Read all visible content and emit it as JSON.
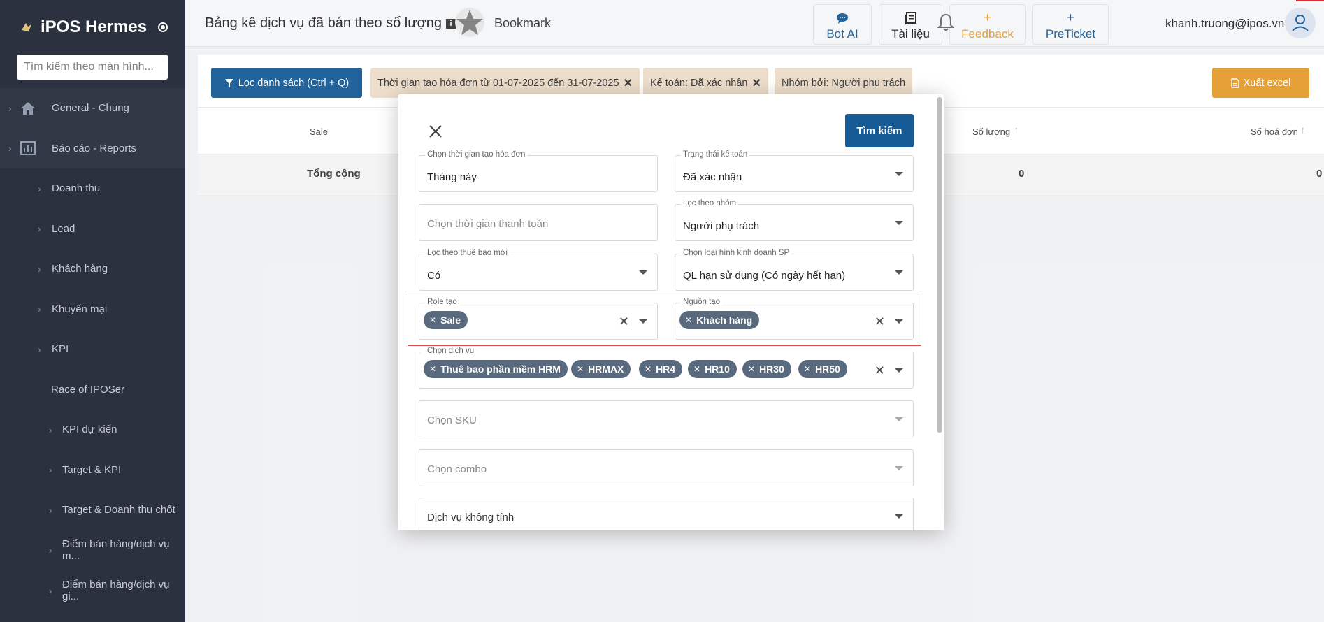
{
  "sidebar": {
    "app_name": "iPOS Hermes",
    "search_placeholder": "Tìm kiếm theo màn hình...",
    "items": [
      {
        "label": "General - Chung"
      },
      {
        "label": "Báo cáo - Reports"
      },
      {
        "label": "Doanh thu"
      },
      {
        "label": "Lead"
      },
      {
        "label": "Khách hàng"
      },
      {
        "label": "Khuyến mại"
      },
      {
        "label": "KPI"
      },
      {
        "label": "Race of IPOSer"
      },
      {
        "label": "KPI dự kiến"
      },
      {
        "label": "Target & KPI"
      },
      {
        "label": "Target & Doanh thu chốt"
      },
      {
        "label": "Điểm bán hàng/dịch vụ m..."
      },
      {
        "label": "Điểm bán hàng/dịch vụ gi..."
      }
    ]
  },
  "header": {
    "title": "Bảng kê dịch vụ đã bán theo số lượng",
    "bookmark": "Bookmark",
    "buttons": {
      "bot_ai": "Bot AI",
      "tai_lieu": "Tài liệu",
      "feedback": "Feedback",
      "preticket": "PreTicket"
    },
    "user_email": "khanh.truong@ipos.vn"
  },
  "toolbar": {
    "filter_button": "Lọc danh sách (Ctrl + Q)",
    "chips": [
      "Thời gian tạo hóa đơn từ 01-07-2025 đến 31-07-2025",
      "Kế toán: Đã xác nhận",
      "Nhóm bởi: Người phụ trách"
    ],
    "export_button": "Xuất excel"
  },
  "table": {
    "headers": {
      "sale": "Sale",
      "so_luong": "Số lượng",
      "so_hoa_don": "Số hoá đơn"
    },
    "total_label": "Tổng cộng",
    "total_so_luong": "0",
    "total_so_hoa_don": "0"
  },
  "modal": {
    "search_button": "Tìm kiếm",
    "fields": {
      "thoi_gian_tao": {
        "label": "Chọn thời gian tạo hóa đơn",
        "value": "Tháng này"
      },
      "trang_thai_ke_toan": {
        "label": "Trạng thái kế toán",
        "value": "Đã xác nhận"
      },
      "thoi_gian_thanh_toan": {
        "placeholder": "Chọn thời gian thanh toán"
      },
      "loc_theo_nhom": {
        "label": "Lọc theo nhóm",
        "value": "Người phụ trách"
      },
      "thue_bao_moi": {
        "label": "Lọc theo thuê bao mới",
        "value": "Có"
      },
      "loai_hinh_kinh_doanh": {
        "label": "Chọn loại hình kinh doanh SP",
        "value": "QL hạn sử dụng (Có ngày hết hạn)"
      },
      "role_tao": {
        "label": "Role tạo",
        "tags": [
          "Sale"
        ]
      },
      "nguon_tao": {
        "label": "Nguồn tạo",
        "tags": [
          "Khách hàng"
        ]
      },
      "dich_vu": {
        "label": "Chọn dịch vụ",
        "tags": [
          "Thuê bao phần mềm HRM",
          "HRMAX",
          "HR4",
          "HR10",
          "HR30",
          "HR50"
        ]
      },
      "sku": {
        "placeholder": "Chọn SKU"
      },
      "combo": {
        "placeholder": "Chọn combo"
      },
      "dich_vu_khong_tinh": {
        "placeholder": "Dịch vụ không tính"
      }
    }
  },
  "colors": {
    "sidebar_bg": "#1f2533",
    "primary": "#165a96",
    "export": "#e59b2c",
    "chip_bg": "#ecdcc8",
    "tag_bg": "#5a6a7e",
    "feedback": "#e59b2c",
    "highlight_border": "#e0464a"
  }
}
